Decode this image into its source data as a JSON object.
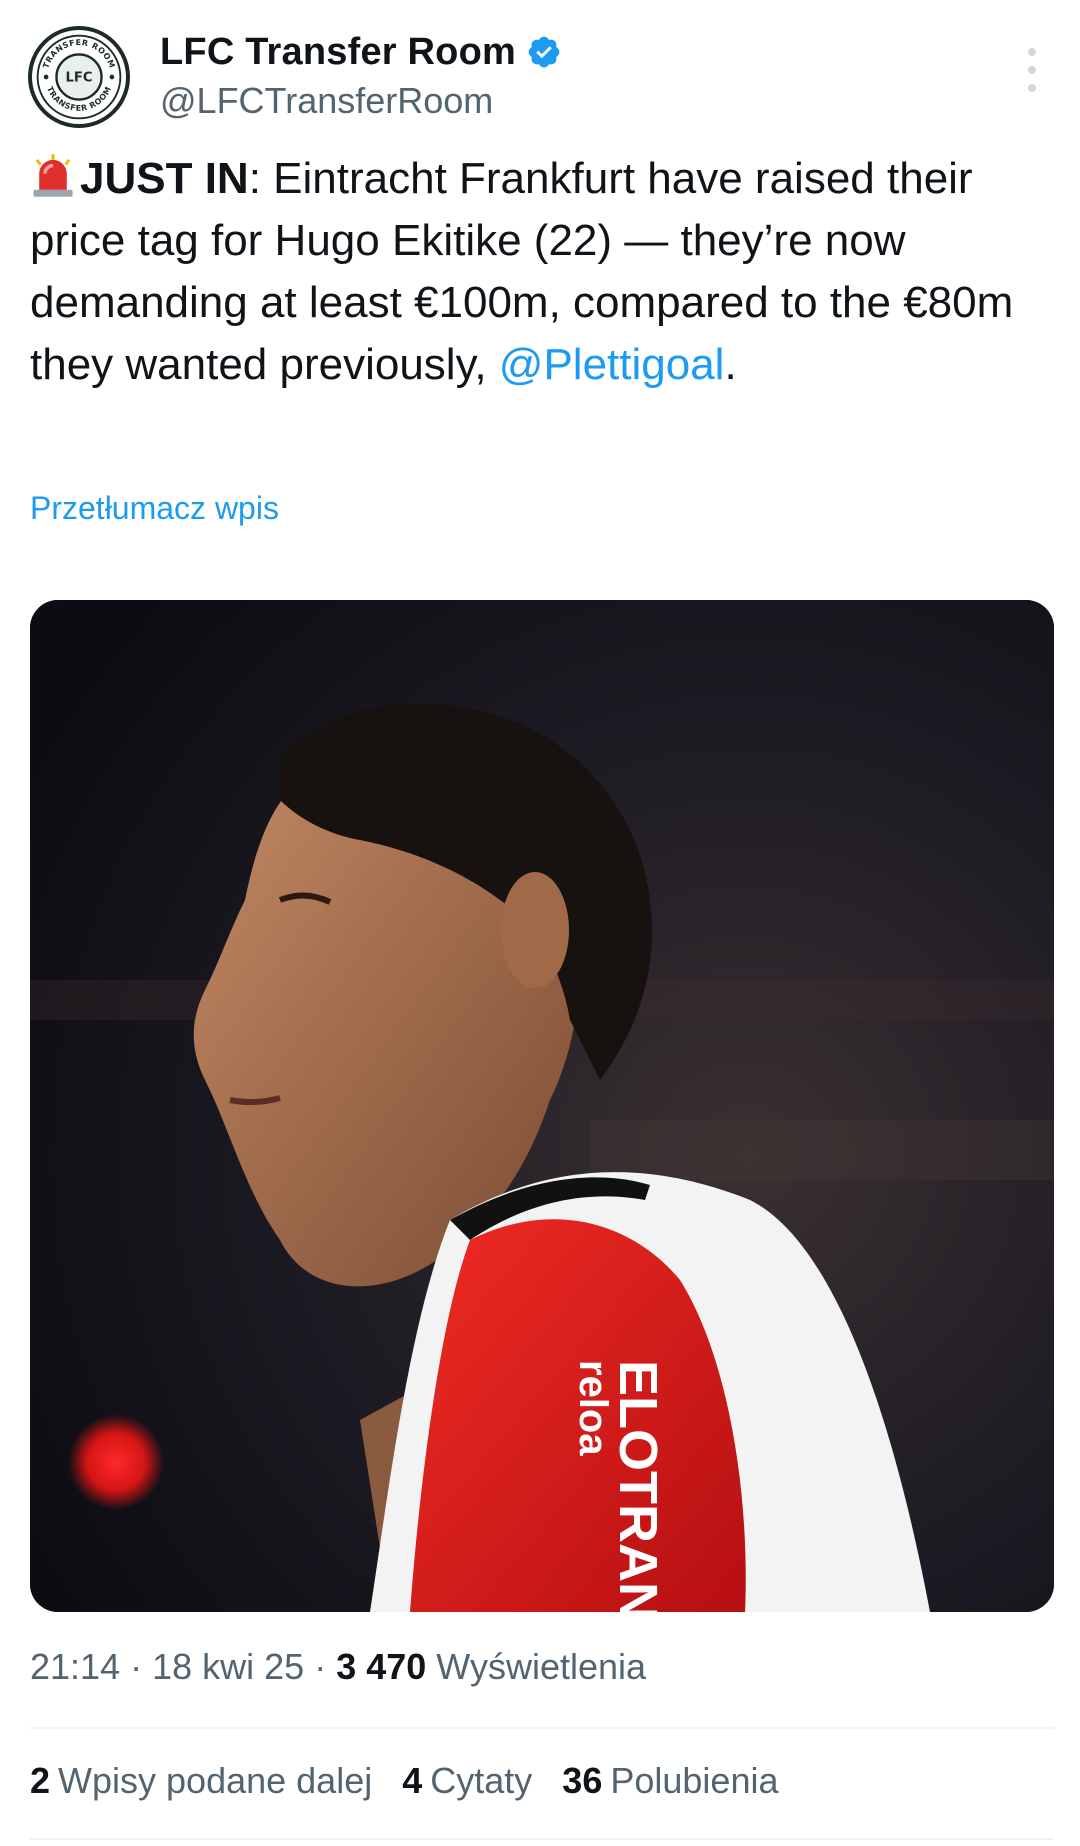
{
  "author": {
    "display_name": "LFC Transfer Room",
    "handle": "@LFCTransferRoom",
    "avatar_text_top": "TRANSFER ROOM",
    "avatar_text_bottom": "TRANSFER ROOM",
    "avatar_monogram": "LFC",
    "verified_icon": "verified-badge-icon"
  },
  "tweet": {
    "siren_icon": "police-light-icon",
    "prefix_bold": "JUST IN",
    "prefix_colon": ":",
    "body": " Eintracht Frankfurt have raised their price tag for Hugo Ekitike (22) — they’re now demanding at least €100m, compared to the €80m they wanted previously,",
    "mention": "@Plettigoal",
    "suffix": ".",
    "translate_label": "Przetłumacz wpis"
  },
  "media": {
    "jersey_text_1": "ELOTRAN",
    "jersey_text_2": "reloa"
  },
  "meta": {
    "time": "21:14",
    "separator": " · ",
    "date": "18 kwi 25",
    "views_count": "3 470",
    "views_label": " Wyświetlenia"
  },
  "stats": {
    "reposts_count": "2",
    "reposts_label": "Wpisy podane dalej",
    "quotes_count": "4",
    "quotes_label": "Cytaty",
    "likes_count": "36",
    "likes_label": "Polubienia"
  },
  "colors": {
    "link": "#1d9bf0",
    "secondary_text": "#536471",
    "primary_text": "#0f1419",
    "jersey_red": "#e3191b"
  }
}
